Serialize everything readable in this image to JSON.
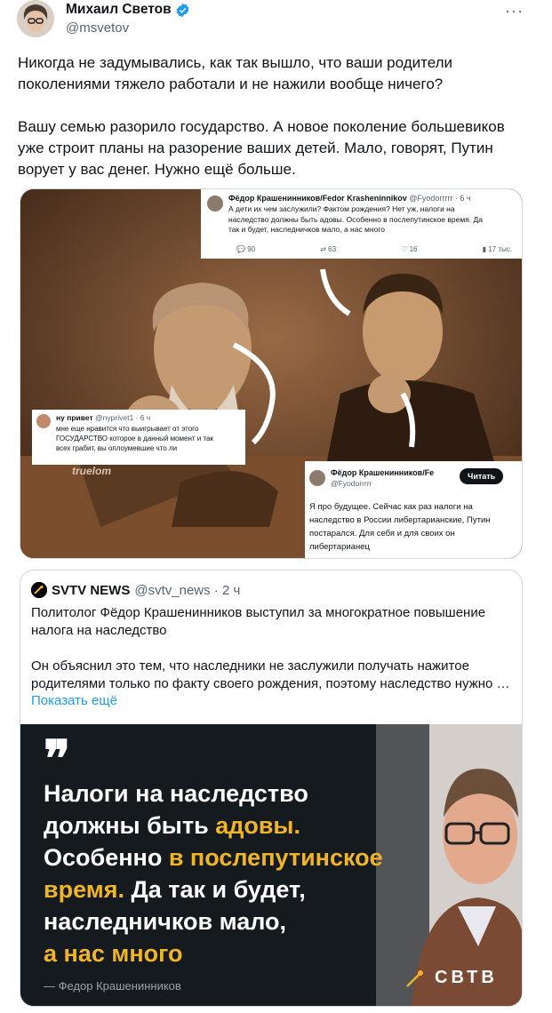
{
  "author": {
    "name": "Михаил Светов",
    "handle": "@msvetov"
  },
  "post": {
    "paragraph1": [
      "Никогда не задумывались, как так вышло, что ваши родители",
      "поколениями тяжело работали и не нажили вообще ничего?"
    ],
    "paragraph2": [
      "Вашу семью разорило государство. А новое поколение большевиков",
      "уже строит планы на разорение ваших детей. Мало, говорят, Путин",
      "ворует у вас денег. Нужно ещё больше."
    ]
  },
  "media": {
    "tweet_top": {
      "name": "Фёдор Крашенинников/Fedor Krasheninnikov",
      "handle": "@Fyodorrrrr · 6 ч",
      "text": [
        "А дети их чем заслужили? Фактом рождения? Нет уж, налоги на",
        "наследство должны быть адовы. Особенно в послепутинское время. Да",
        "так и будет, наследничков мало, а нас много"
      ],
      "stats": [
        "90",
        "63",
        "16",
        "17 тыс."
      ]
    },
    "tweet_left": {
      "name": "ну привет",
      "handle": "@nyprivet1 · 6 ч",
      "text": [
        "мне еще нравится что выигрывает от этого",
        "ГОСУДАРСТВО которое в данный момент и так",
        "всех грабит, вы оплоумевшие что ли"
      ]
    },
    "tweet_right": {
      "name": "Фёдор Крашенинников/Fe",
      "handle": "@Fyodorrrrr",
      "follow": "Читать",
      "text": [
        "Я про будущее. Сейчас как раз налоги на",
        "наследство в России либертарианские, Путин",
        "постарался. Для себя и для своих он",
        "либертарианец"
      ]
    },
    "watermark": "truelom"
  },
  "quote": {
    "name": "SVTV NEWS",
    "handle": "@svtv_news · 2 ч",
    "lines1": [
      "Политолог Фёдор Крашенинников выступил за многократное повышение",
      "налога на наследство"
    ],
    "lines2": [
      "Он объяснил это тем, что наследники не заслужили получать нажитое",
      "родителями только по факту своего рождения, поэтому наследство нужно …"
    ],
    "show_more": "Показать ещё",
    "card": {
      "l1": "Налоги на наследство",
      "l2a": "должны быть ",
      "l2b": "адовы.",
      "l3a": "Особенно ",
      "l3b": "в послепутинское",
      "l4a": "время.",
      "l4b": " Да так и будет,",
      "l5": "наследничков мало,",
      "l6": "а нас много",
      "attribution": "— Федор Крашенинников",
      "logo": "СВТВ"
    }
  },
  "colors": {
    "accent": "#1d9bf0",
    "highlight": "#f0b429",
    "sepia": "#6b4528"
  }
}
